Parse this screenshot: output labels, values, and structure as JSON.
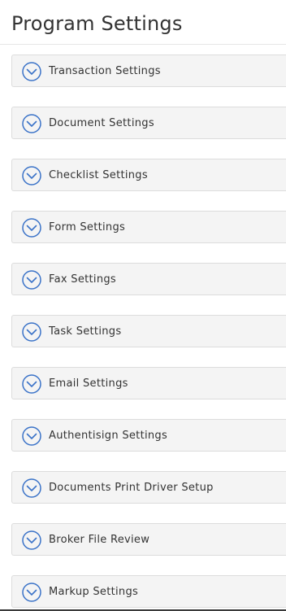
{
  "page": {
    "title": "Program Settings"
  },
  "colors": {
    "accent": "#3b73c8",
    "panel_background": "#f4f4f4",
    "panel_border": "#dcdcdc",
    "text": "#333333"
  },
  "panels": [
    {
      "label": "Transaction Settings",
      "icon": "chevron-down-circle-icon"
    },
    {
      "label": "Document Settings",
      "icon": "chevron-down-circle-icon"
    },
    {
      "label": "Checklist Settings",
      "icon": "chevron-down-circle-icon"
    },
    {
      "label": "Form Settings",
      "icon": "chevron-down-circle-icon"
    },
    {
      "label": "Fax Settings",
      "icon": "chevron-down-circle-icon"
    },
    {
      "label": "Task Settings",
      "icon": "chevron-down-circle-icon"
    },
    {
      "label": "Email Settings",
      "icon": "chevron-down-circle-icon"
    },
    {
      "label": "Authentisign Settings",
      "icon": "chevron-down-circle-icon"
    },
    {
      "label": "Documents Print Driver Setup",
      "icon": "chevron-down-circle-icon"
    },
    {
      "label": "Broker File Review",
      "icon": "chevron-down-circle-icon"
    },
    {
      "label": "Markup Settings",
      "icon": "chevron-down-circle-icon"
    }
  ]
}
